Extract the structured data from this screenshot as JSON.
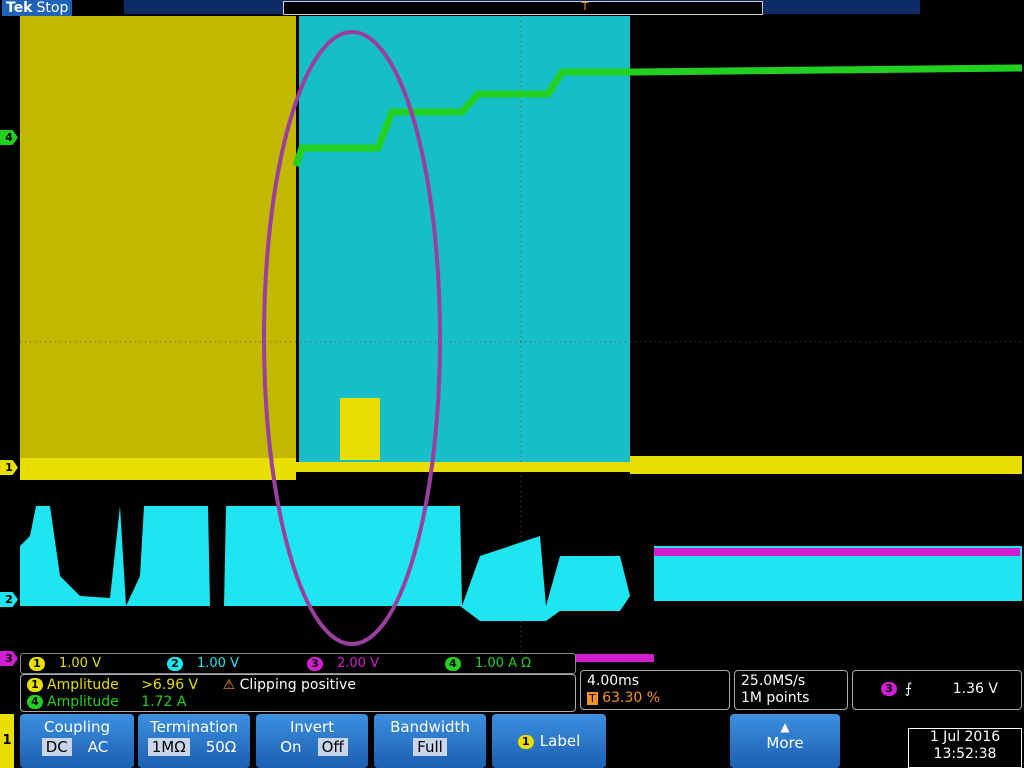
{
  "header": {
    "brand": "Tek",
    "state": "Stop",
    "trigger_marker": "T"
  },
  "channels": [
    {
      "id": "1",
      "marker": "1",
      "color": "#e8df00",
      "scale": "1.00 V"
    },
    {
      "id": "2",
      "marker": "2",
      "color": "#1ee6f0",
      "scale": "1.00 V"
    },
    {
      "id": "3",
      "marker": "3",
      "color": "#d01ed0",
      "scale": "2.00 V"
    },
    {
      "id": "4",
      "marker": "4",
      "color": "#22d022",
      "scale": "1.00 A",
      "unit_suffix": "Ω"
    }
  ],
  "measurements": [
    {
      "ch": "1",
      "name": "Amplitude",
      "value": ">6.96 V",
      "warning": "Clipping positive"
    },
    {
      "ch": "4",
      "name": "Amplitude",
      "value": "1.72 A"
    }
  ],
  "horizontal": {
    "timebase": "4.00ms",
    "trigger_pos": "63.30 %"
  },
  "acquisition": {
    "sample_rate": "25.0MS/s",
    "record_length": "1M points"
  },
  "trigger": {
    "source": "3",
    "slope_symbol": "⨍",
    "level": "1.36 V"
  },
  "menu": {
    "side_label": "1",
    "coupling": {
      "title": "Coupling",
      "opt_a": "DC",
      "opt_b": "AC"
    },
    "termination": {
      "title": "Termination",
      "opt_a": "1MΩ",
      "opt_b": "50Ω"
    },
    "invert": {
      "title": "Invert",
      "opt_a": "On",
      "opt_b": "Off"
    },
    "bandwidth": {
      "title": "Bandwidth",
      "value": "Full"
    },
    "label": {
      "badge": "1",
      "title": "Label"
    },
    "more": {
      "arrow": "▲",
      "title": "More"
    }
  },
  "datetime": {
    "date": "1 Jul  2016",
    "time": "13:52:38"
  },
  "colors": {
    "ch1": "#e8df00",
    "ch2": "#1ee6f0",
    "ch3": "#d01ed0",
    "ch4": "#22d022",
    "annotation": "#9b3ea0"
  }
}
